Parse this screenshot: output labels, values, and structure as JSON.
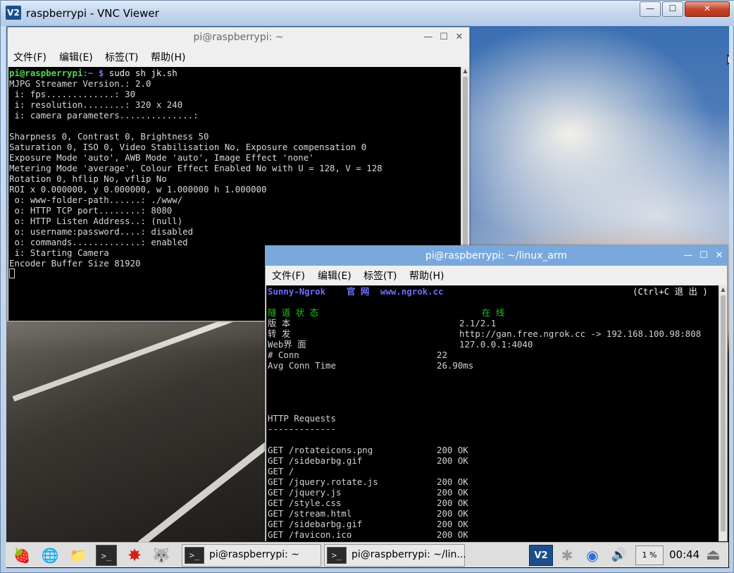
{
  "vnc": {
    "title": "raspberrypi - VNC Viewer",
    "logo_text": "V2",
    "controls": {
      "minimize": "—",
      "maximize": "☐",
      "close": "✕"
    }
  },
  "terminal1": {
    "title": "pi@raspberrypi: ~",
    "menu": [
      "文件(F)",
      "编辑(E)",
      "标签(T)",
      "帮助(H)"
    ],
    "prompt_user": "pi@raspberrypi",
    "prompt_path": ":~ $",
    "command": " sudo sh jk.sh",
    "lines": [
      "MJPG Streamer Version.: 2.0",
      " i: fps.............: 30",
      " i: resolution........: 320 x 240",
      " i: camera parameters..............:",
      "",
      "Sharpness 0, Contrast 0, Brightness 50",
      "Saturation 0, ISO 0, Video Stabilisation No, Exposure compensation 0",
      "Exposure Mode 'auto', AWB Mode 'auto', Image Effect 'none'",
      "Metering Mode 'average', Colour Effect Enabled No with U = 128, V = 128",
      "Rotation 0, hflip No, vflip No",
      "ROI x 0.000000, y 0.000000, w 1.000000 h 1.000000",
      " o: www-folder-path......: ./www/",
      " o: HTTP TCP port........: 8080",
      " o: HTTP Listen Address..: (null)",
      " o: username:password....: disabled",
      " o: commands.............: enabled",
      " i: Starting Camera",
      "Encoder Buffer Size 81920"
    ]
  },
  "terminal2": {
    "title": "pi@raspberrypi: ~/linux_arm",
    "menu": [
      "文件(F)",
      "编辑(E)",
      "标签(T)",
      "帮助(H)"
    ],
    "header_brand": "Sunny-Ngrok",
    "header_site_label": "官 网",
    "header_site_url": "www.ngrok.cc",
    "header_exit": "(Ctrl+C 退 出 )",
    "status_label": "隧 道 状 态",
    "status_value": "在 线",
    "rows": [
      {
        "label": "版 本",
        "value": "2.1/2.1",
        "col": 2
      },
      {
        "label": "转 发",
        "value": "http://gan.free.ngrok.cc -> 192.168.100.98:808",
        "col": 2
      },
      {
        "label": "Web界 面",
        "value": "127.0.0.1:4040",
        "col": 2
      },
      {
        "label": "# Conn",
        "value": "22",
        "col": 1
      },
      {
        "label": "Avg Conn Time",
        "value": "26.90ms",
        "col": 1
      }
    ],
    "requests_title": "HTTP Requests",
    "requests_rule": "-------------",
    "requests": [
      {
        "path": "GET /rotateicons.png",
        "status": "200 OK"
      },
      {
        "path": "GET /sidebarbg.gif",
        "status": "200 OK"
      },
      {
        "path": "GET /",
        "status": ""
      },
      {
        "path": "GET /jquery.rotate.js",
        "status": "200 OK"
      },
      {
        "path": "GET /jquery.js",
        "status": "200 OK"
      },
      {
        "path": "GET /style.css",
        "status": "200 OK"
      },
      {
        "path": "GET /stream.html",
        "status": "200 OK"
      },
      {
        "path": "GET /sidebarbg.gif",
        "status": "200 OK"
      },
      {
        "path": "GET /favicon.ico",
        "status": "200 OK"
      }
    ]
  },
  "taskbar": {
    "launchers": [
      {
        "name": "raspberry-menu-icon",
        "glyph": "🍓"
      },
      {
        "name": "web-browser-icon",
        "glyph": "🌐"
      },
      {
        "name": "file-manager-icon",
        "glyph": "📁"
      },
      {
        "name": "terminal-icon",
        "glyph": ">_"
      },
      {
        "name": "mathematica-icon",
        "glyph": "✸"
      },
      {
        "name": "wolfram-icon",
        "glyph": "🐺"
      }
    ],
    "tasks": [
      {
        "label": "pi@raspberrypi: ~"
      },
      {
        "label": "pi@raspberrypi: ~/lin..."
      }
    ],
    "tray": {
      "vnc_glyph": "V2",
      "bluetooth_glyph": "✱",
      "wifi_glyph": "◉",
      "volume_glyph": "🔊",
      "cpu": "1 %",
      "clock": "00:44",
      "eject_glyph": "⏏"
    }
  }
}
